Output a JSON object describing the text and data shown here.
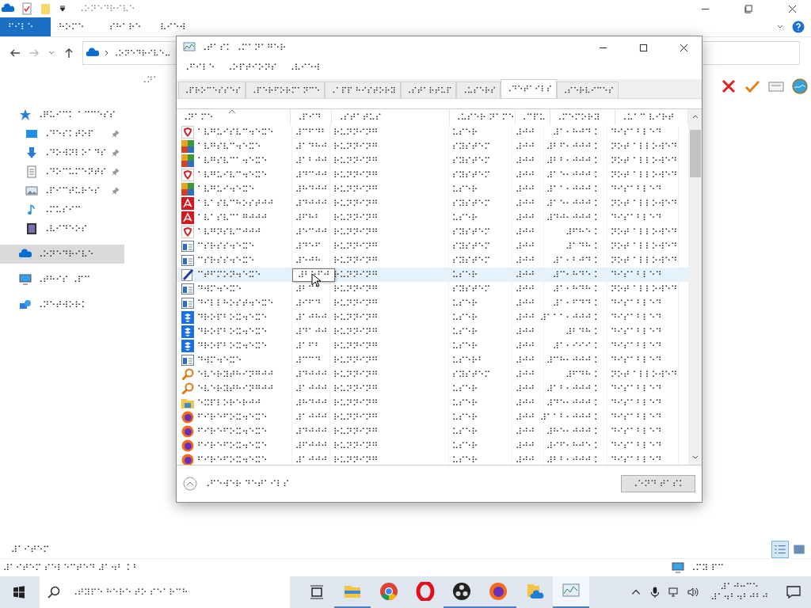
{
  "explorer": {
    "title": "⠠⠕⠝⠑⠙⠗⠊⠧⠑",
    "ribbon_tabs": [
      {
        "label": "⠋⠊⠇⠑",
        "selected": true
      },
      {
        "label": "⠓⠕⠍⠑",
        "selected": false
      },
      {
        "label": "⠎⠓⠁⠗⠑",
        "selected": false
      },
      {
        "label": "⠧⠊⠑⠺",
        "selected": false
      }
    ],
    "address": "⠠⠕⠝⠑⠙⠗⠊⠧⠑⠤",
    "sidebar": [
      {
        "kind": "star",
        "label": "⠠⠟⠥⠊⠉⠅ ⠁⠉⠉⠑⠎⠎",
        "pinned": false,
        "selected": false
      },
      {
        "kind": "desktop",
        "label": "⠠⠙⠑⠎⠅⠞⠕⠏",
        "pinned": true,
        "selected": false
      },
      {
        "kind": "download",
        "label": "⠠⠙⠕⠺⠝⠇⠕⠁⠙⠎",
        "pinned": true,
        "selected": false
      },
      {
        "kind": "document",
        "label": "⠠⠙⠕⠉⠥⠍⠑⠝⠞⠎",
        "pinned": true,
        "selected": false
      },
      {
        "kind": "picture",
        "label": "⠠⠏⠊⠉⠞⠥⠗⠑⠎",
        "pinned": true,
        "selected": false
      },
      {
        "kind": "music",
        "label": "⠠⠍⠥⠎⠊⠉",
        "pinned": false,
        "selected": false
      },
      {
        "kind": "video",
        "label": "⠠⠧⠊⠙⠑⠕⠎",
        "pinned": false,
        "selected": false
      },
      {
        "kind": "cloud",
        "label": "⠠⠕⠝⠑⠙⠗⠊⠧⠑",
        "pinned": false,
        "selected": true
      },
      {
        "kind": "pc",
        "label": "⠠⠞⠓⠊⠎ ⠠⠏⠉",
        "pinned": false,
        "selected": false
      },
      {
        "kind": "network",
        "label": "⠠⠝⠑⠞⠺⠕⠗⠅",
        "pinned": false,
        "selected": false
      }
    ],
    "column_header": "⠠⠝⠁",
    "item_count": "⠼⠁⠊⠞⠑⠍",
    "status_bar": "⠼⠁⠊⠞⠑⠍ ⠎⠑⠇⠑⠉⠞⠑⠙ ⠼⠁⠲⠃ ⠅⠃",
    "status_right": "⠠⠍⠽ ⠏⠉"
  },
  "task_manager": {
    "title": "⠠⠞⠁⠎⠅ ⠠⠍⠁⠝⠁⠛⠑⠗",
    "menu": [
      "⠠⠋⠊⠇⠑",
      "⠠⠕⠏⠞⠊⠕⠝⠎",
      "⠠⠧⠊⠑⠺"
    ],
    "tabs": [
      {
        "label": "⠠⠏⠗⠕⠉⠑⠎⠎⠑⠎",
        "selected": false
      },
      {
        "label": "⠠⠏⠑⠗⠋⠕⠗⠍⠁⠝⠉⠑",
        "selected": false
      },
      {
        "label": "⠠⠁⠏⠏ ⠓⠊⠎⠞⠕⠗⠽",
        "selected": false
      },
      {
        "label": "⠠⠎⠞⠁⠗⠞⠥⠏",
        "selected": false
      },
      {
        "label": "⠠⠥⠎⠑⠗⠎",
        "selected": false
      },
      {
        "label": "⠠⠙⠑⠞⠁⠊⠇⠎",
        "selected": true
      },
      {
        "label": "⠠⠎⠑⠗⠧⠊⠉⠑⠎",
        "selected": false
      }
    ],
    "columns": [
      "⠠⠝⠁⠍⠑",
      "⠠⠏⠊⠙",
      "⠠⠎⠞⠁⠞⠥⠎",
      "⠠⠥⠎⠑⠗ ⠝⠁⠍⠑",
      "⠠⠉⠏⠥",
      "⠠⠍⠑⠍⠕⠗⠽",
      "⠠⠥⠁⠉ ⠧⠊⠗⠞"
    ],
    "rows": [
      {
        "kind": "shield",
        "name": "⠁⠧⠛⠥⠊⠎⠧⠉⠲⠑⠭⠑",
        "pid": "⠼⠉⠋⠙⠃",
        "status": "⠗⠥⠝⠝⠊⠝⠛",
        "user": "⠥⠎⠑⠗",
        "cpu": "⠼⠚⠚",
        "memory": "⠼⠁⠂⠓⠚⠙ ⠅",
        "uac": "⠙⠊⠎⠁⠃⠇⠑⠙",
        "selected": false
      },
      {
        "kind": "tiles",
        "name": "⠁⠧⠛⠎⠧⠉⠲⠑⠭⠑",
        "pid": "⠼⠁⠙⠓⠚",
        "status": "⠗⠥⠝⠝⠊⠝⠛",
        "user": "⠎⠽⠎⠞⠑⠍",
        "cpu": "⠼⠚⠚",
        "memory": "⠼⠃⠋⠂⠚⠚⠚ ⠅",
        "uac": "⠝⠕⠞ ⠁⠇⠇⠕⠺⠑⠙",
        "selected": false
      },
      {
        "kind": "tiles",
        "name": "⠁⠧⠛⠎⠧⠉⠁⠲⠑⠭⠑",
        "pid": "⠼⠁⠃⠚⠚",
        "status": "⠗⠥⠝⠝⠊⠝⠛",
        "user": "⠎⠽⠎⠞⠑⠍",
        "cpu": "⠼⠚⠚",
        "memory": "⠼⠃⠃⠂⠚⠚⠚ ⠅",
        "uac": "⠝⠕⠞ ⠁⠇⠇⠕⠺⠑⠙",
        "selected": false
      },
      {
        "kind": "shield",
        "name": "⠁⠧⠛⠥⠊⠧⠉⠲⠑⠭⠑",
        "pid": "⠼⠙⠉⠚⠚",
        "status": "⠗⠥⠝⠝⠊⠝⠛",
        "user": "⠎⠽⠎⠞⠑⠍",
        "cpu": "⠼⠚⠚",
        "memory": "⠼⠁⠑⠂⠚⠚⠚ ⠅",
        "uac": "⠝⠕⠞ ⠁⠇⠇⠕⠺⠑⠙",
        "selected": false
      },
      {
        "kind": "tiles",
        "name": "⠁⠧⠛⠥⠊⠲⠑⠭⠑",
        "pid": "⠼⠓⠙⠚⠚",
        "status": "⠗⠥⠝⠝⠊⠝⠛",
        "user": "⠥⠎⠑⠗",
        "cpu": "⠼⠚⠚",
        "memory": "⠼⠁⠁⠂⠚⠚⠚ ⠅",
        "uac": "⠙⠊⠎⠁⠃⠇⠑⠙",
        "selected": false
      },
      {
        "kind": "avira",
        "name": "⠁⠧⠁⠎⠧⠉⠓⠕⠎⠞⠚⠚",
        "pid": "⠼⠙⠚⠚⠚",
        "status": "⠗⠥⠝⠝⠊⠝⠛",
        "user": "⠎⠽⠎⠞⠑⠍",
        "cpu": "⠼⠚⠚",
        "memory": "⠼⠁⠑⠂⠚⠚⠚ ⠅",
        "uac": "⠝⠕⠞ ⠁⠇⠇⠕⠺⠑⠙",
        "selected": false
      },
      {
        "kind": "avira",
        "name": "⠁⠧⠁⠎⠧⠉⠁⠛⠚⠚⠚",
        "pid": "⠼⠋⠓⠃",
        "status": "⠗⠥⠝⠝⠊⠝⠛",
        "user": "⠥⠎⠑⠗",
        "cpu": "⠼⠚⠚",
        "memory": "⠼⠙⠚⠂⠚⠚⠚ ⠅",
        "uac": "⠙⠊⠎⠁⠃⠇⠑⠙",
        "selected": false
      },
      {
        "kind": "shield",
        "name": "⠁⠧⠛⠝⠎⠧⠉⠚⠚⠚",
        "pid": "⠼⠑⠉⠚⠚",
        "status": "⠗⠥⠝⠝⠊⠝⠛",
        "user": "⠎⠽⠎⠞⠑⠍",
        "cpu": "⠼⠚⠚",
        "memory": "⠼⠋⠓⠑ ⠅",
        "uac": "⠝⠕⠞ ⠁⠇⠇⠕⠺⠑⠙",
        "selected": false
      },
      {
        "kind": "window",
        "name": "⠉⠎⠗⠎⠎⠲⠑⠭⠑",
        "pid": "⠼⠙⠑⠋",
        "status": "⠗⠥⠝⠝⠊⠝⠛",
        "user": "⠎⠽⠎⠞⠑⠍",
        "cpu": "⠼⠚⠚",
        "memory": "⠼⠁⠙⠓ ⠅",
        "uac": "⠝⠕⠞ ⠁⠇⠇⠕⠺⠑⠙",
        "selected": false
      },
      {
        "kind": "window",
        "name": "⠉⠎⠗⠎⠎⠲⠑⠭⠑",
        "pid": "⠼⠑⠚⠓",
        "status": "⠗⠥⠝⠝⠊⠝⠛",
        "user": "⠎⠽⠎⠞⠑⠍",
        "cpu": "⠼⠚⠚",
        "memory": "⠼⠁⠂⠃⠚⠙ ⠅",
        "uac": "⠝⠕⠞ ⠁⠇⠇⠕⠺⠑⠙",
        "selected": false
      },
      {
        "kind": "pencil",
        "name": "⠉⠞⠋⠍⠕⠝⠲⠑⠭⠑",
        "tooltip": "⠼⠃⠑⠋⠚",
        "status": "⠗⠥⠝⠝⠊⠝⠛",
        "user": "⠥⠎⠑⠗",
        "cpu": "⠼⠚⠚",
        "memory": "⠼⠉⠂⠓⠙⠑ ⠅",
        "uac": "⠙⠊⠎⠁⠃⠇⠑⠙",
        "selected": true
      },
      {
        "kind": "window",
        "name": "⠙⠺⠍⠲⠑⠭⠑",
        "pid": "⠼⠃⠉⠁",
        "status": "⠗⠥⠝⠝⠊⠝⠛",
        "user": "⠎⠽⠎⠞⠑⠍",
        "cpu": "⠼⠚⠚",
        "memory": "⠼⠁⠂⠓⠙⠓ ⠅",
        "uac": "⠝⠕⠞ ⠁⠇⠇⠕⠺⠑⠙",
        "selected": false
      },
      {
        "kind": "window",
        "name": "⠙⠊⠇⠇⠓⠕⠎⠞⠲⠑⠭⠑",
        "pid": "⠼⠊⠋⠙",
        "status": "⠗⠥⠝⠝⠊⠝⠛",
        "user": "⠥⠎⠑⠗",
        "cpu": "⠼⠚⠚",
        "memory": "⠼⠁⠂⠋⠙⠙ ⠅",
        "uac": "⠙⠊⠎⠁⠃⠇⠑⠙",
        "selected": false
      },
      {
        "kind": "dropbox",
        "name": "⠙⠗⠕⠏⠃⠕⠭⠲⠑⠭⠑",
        "pid": "⠼⠁⠚⠓⠚",
        "status": "⠗⠥⠝⠝⠊⠝⠛",
        "user": "⠥⠎⠑⠗",
        "cpu": "⠼⠚⠚",
        "memory": "⠼⠁⠁⠁⠂⠚⠚⠚ ⠅",
        "uac": "⠙⠊⠎⠁⠃⠇⠑⠙",
        "selected": false
      },
      {
        "kind": "dropbox",
        "name": "⠙⠗⠕⠏⠃⠕⠭⠲⠑⠭⠑",
        "pid": "⠼⠙⠁⠚⠚",
        "status": "⠗⠥⠝⠝⠊⠝⠛",
        "user": "⠥⠎⠑⠗",
        "cpu": "⠼⠚⠚",
        "memory": "⠼⠃⠙⠓ ⠅",
        "uac": "⠙⠊⠎⠁⠃⠇⠑⠙",
        "selected": false
      },
      {
        "kind": "dropbox",
        "name": "⠙⠗⠕⠏⠃⠕⠭⠲⠑⠭⠑",
        "pid": "⠼⠁⠋⠃",
        "status": "⠗⠥⠝⠝⠊⠝⠛",
        "user": "⠥⠎⠑⠗",
        "cpu": "⠼⠚⠚",
        "memory": "⠼⠁⠂⠊⠊⠊ ⠅",
        "uac": "⠙⠊⠎⠁⠃⠇⠑⠙",
        "selected": false
      },
      {
        "kind": "window",
        "name": "⠙⠺⠍⠲⠑⠭⠑",
        "pid": "⠼⠉⠉⠙",
        "status": "⠗⠥⠝⠝⠊⠝⠛",
        "user": "⠥⠎⠑⠗⠃",
        "cpu": "⠼⠚⠚",
        "memory": "⠼⠉⠓⠂⠚⠚⠚ ⠅",
        "uac": "⠙⠊⠎⠁⠃⠇⠑⠙",
        "selected": false
      },
      {
        "kind": "magnifier",
        "name": "⠑⠧⠑⠗⠽⠞⠓⠊⠝⠛⠚⠚",
        "pid": "⠼⠙⠚⠚⠚",
        "status": "⠗⠥⠝⠝⠊⠝⠛",
        "user": "⠎⠽⠎⠞⠑⠍",
        "cpu": "⠼⠚⠚",
        "memory": "⠼⠋⠙⠓ ⠅",
        "uac": "⠝⠕⠞ ⠁⠇⠇⠕⠺⠑⠙",
        "selected": false
      },
      {
        "kind": "magnifier",
        "name": "⠑⠧⠑⠗⠽⠞⠓⠊⠝⠛⠚⠚",
        "pid": "⠼⠁⠚⠚⠚",
        "status": "⠗⠥⠝⠝⠊⠝⠛",
        "user": "⠥⠎⠑⠗",
        "cpu": "⠼⠚⠚",
        "memory": "⠼⠁⠃⠂⠚⠚⠚ ⠅",
        "uac": "⠙⠊⠎⠁⠃⠇⠑⠙",
        "selected": false
      },
      {
        "kind": "folder",
        "name": "⠑⠭⠏⠇⠕⠗⠑⠗⠚⠚",
        "pid": "⠼⠓⠙⠚⠚",
        "status": "⠗⠥⠝⠝⠊⠝⠛",
        "user": "⠥⠎⠑⠗",
        "cpu": "⠼⠚⠚",
        "memory": "⠼⠙⠑⠂⠚⠚⠚ ⠅",
        "uac": "⠙⠊⠎⠁⠃⠇⠑⠙",
        "selected": false
      },
      {
        "kind": "firefox",
        "name": "⠋⠊⠗⠑⠋⠕⠭⠲⠑⠭⠑",
        "pid": "⠼⠁⠚⠚⠚",
        "status": "⠗⠥⠝⠝⠊⠝⠛",
        "user": "⠥⠎⠑⠗",
        "cpu": "⠼⠚⠚",
        "memory": "⠼⠁⠁⠃⠂⠚⠚⠚ ⠅",
        "uac": "⠙⠊⠎⠁⠃⠇⠑⠙",
        "selected": false
      },
      {
        "kind": "firefox",
        "name": "⠋⠊⠗⠑⠋⠕⠭⠲⠑⠭⠑",
        "pid": "⠼⠙⠚⠚⠚",
        "status": "⠗⠥⠝⠝⠊⠝⠛",
        "user": "⠥⠎⠑⠗",
        "cpu": "⠼⠚⠚",
        "memory": "⠼⠓⠑⠂⠚⠚⠚ ⠅",
        "uac": "⠙⠊⠎⠁⠃⠇⠑⠙",
        "selected": false
      },
      {
        "kind": "firefox",
        "name": "⠋⠊⠗⠑⠋⠕⠭⠲⠑⠭⠑",
        "pid": "⠼⠋⠚⠚⠚",
        "status": "⠗⠥⠝⠝⠊⠝⠛",
        "user": "⠥⠎⠑⠗",
        "cpu": "⠼⠚⠚",
        "memory": "⠼⠊⠋⠂⠓⠚⠑ ⠅",
        "uac": "⠙⠊⠎⠁⠃⠇⠑⠙",
        "selected": false
      },
      {
        "kind": "firefox",
        "name": "⠋⠊⠗⠑⠋⠕⠭⠲⠑⠭⠑",
        "pid": "⠼⠁⠚⠚⠚",
        "status": "⠗⠥⠝⠝⠊⠝⠛",
        "user": "⠥⠎⠑⠗",
        "cpu": "⠼⠚⠚",
        "memory": "⠼⠃⠃⠂⠚⠚⠚ ⠅",
        "uac": "⠙⠊⠎⠁⠃⠇⠑⠙",
        "selected": false
      }
    ],
    "fewer_details": "⠠⠋⠑⠺⠑⠗ ⠙⠑⠞⠁⠊⠇⠎",
    "end_task": "⠠⠑⠝⠙ ⠞⠁⠎⠅"
  },
  "taskbar": {
    "search_placeholder": "⠠⠞⠽⠏⠑ ⠓⠑⠗⠑ ⠞⠕ ⠎⠑⠁⠗⠉⠓",
    "apps": [
      {
        "kind": "explorer",
        "running": true,
        "active": false
      },
      {
        "kind": "chrome",
        "running": false,
        "active": false
      },
      {
        "kind": "opera",
        "running": false,
        "active": false
      },
      {
        "kind": "obs",
        "running": true,
        "active": false
      },
      {
        "kind": "firefox",
        "running": true,
        "active": false
      },
      {
        "kind": "onedrive",
        "running": false,
        "active": false
      },
      {
        "kind": "taskmgr",
        "running": true,
        "active": true
      }
    ],
    "time": "⠼⠁⠚⠒⠉⠑",
    "date": "⠼⠁⠲⠃⠲⠃⠚⠃⠚"
  }
}
